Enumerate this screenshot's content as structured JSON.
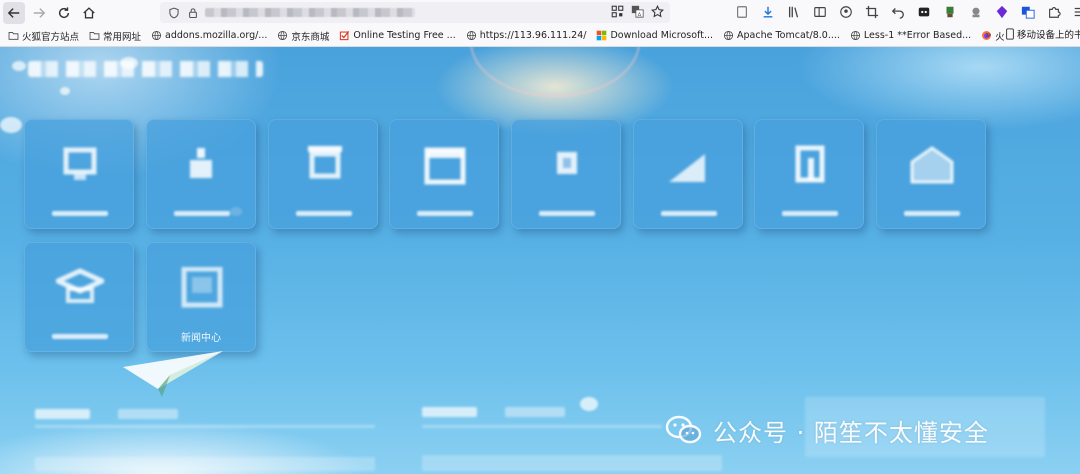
{
  "browser": {
    "bookmarks": [
      {
        "icon": "folder-icon",
        "label": "火狐官方站点"
      },
      {
        "icon": "folder-icon",
        "label": "常用网址"
      },
      {
        "icon": "globe-icon",
        "label": "addons.mozilla.org/..."
      },
      {
        "icon": "globe-icon",
        "label": "京东商城"
      },
      {
        "icon": "checkbox-icon",
        "label": "Online Testing Free ..."
      },
      {
        "icon": "globe-icon",
        "label": "https://113.96.111.24/"
      },
      {
        "icon": "microsoft-icon",
        "label": "Download Microsoft..."
      },
      {
        "icon": "globe-icon",
        "label": "Apache Tomcat/8.0...."
      },
      {
        "icon": "globe-icon",
        "label": "Less-1 **Error Based..."
      },
      {
        "icon": "firefox-icon",
        "label": "火狐主页"
      }
    ],
    "bookmarks_more": "»",
    "mobile_bookmarks": "移动设备上的书签"
  },
  "tiles": [
    {
      "label": ""
    },
    {
      "label": ""
    },
    {
      "label": ""
    },
    {
      "label": ""
    },
    {
      "label": ""
    },
    {
      "label": ""
    },
    {
      "label": ""
    },
    {
      "label": ""
    },
    {
      "label": ""
    },
    {
      "label": "新闻中心"
    }
  ],
  "watermark": {
    "text": "公众号 · 陌笙不太懂安全"
  },
  "colors": {
    "page_bg_top": "#4aa2dc",
    "page_bg_bottom": "#8bd0f2",
    "tile_bg": "rgba(70,160,220,.72)"
  }
}
